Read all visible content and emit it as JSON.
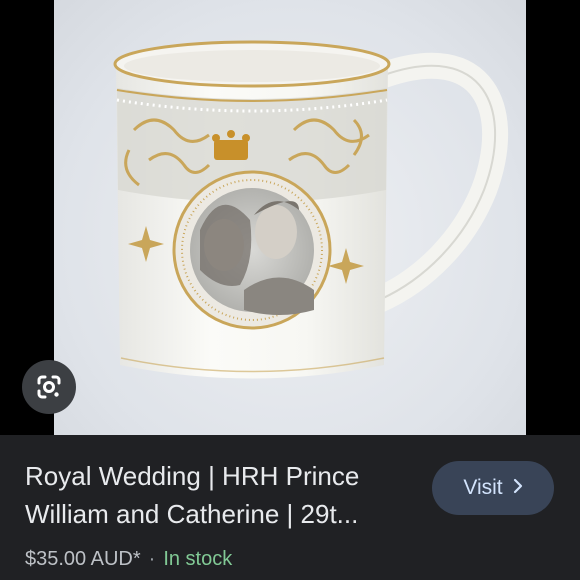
{
  "product": {
    "title": "Royal Wedding | HRH Prince William and Catherine | 29t...",
    "price": "$35.00 AUD*",
    "separator": "·",
    "stock_status": "In stock"
  },
  "actions": {
    "visit_label": "Visit",
    "visit_icon": "chevron-right-icon",
    "lens_icon": "google-lens-icon"
  },
  "image": {
    "subject": "commemorative-mug-photo"
  },
  "colors": {
    "background": "#202124",
    "visit_button_bg": "#394457",
    "stock_green": "#81c995",
    "gold_trim": "#c9a65a"
  }
}
